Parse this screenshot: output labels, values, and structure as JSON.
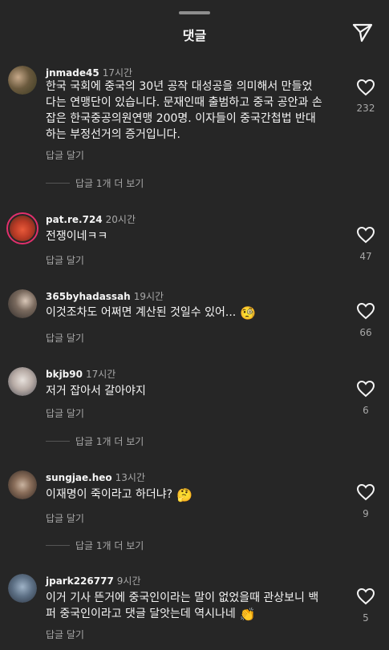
{
  "header": {
    "title": "댓글"
  },
  "comments": [
    {
      "username": "jnmade45",
      "time": "17시간",
      "text": "한국 국회에 중국의 30년 공작 대성공을 의미해서 만들었\n다는 연맹단이 있습니다. 문재인때 출범하고 중국 공안과 손\n잡은 한국중공의원연맹 200명. 이자들이 중국간첩법 반대\n하는 부정선거의 증거입니다.",
      "reply_label": "답글 달기",
      "likes": "232",
      "more_replies": "답글 1개 더 보기"
    },
    {
      "username": "pat.re.724",
      "time": "20시간",
      "text": "전쟁이네ㅋㅋ",
      "reply_label": "답글 달기",
      "likes": "47"
    },
    {
      "username": "365byhadassah",
      "time": "19시간",
      "text": "이것조차도 어쩌면 계산된 것일수 있어...",
      "emoji": "🧐",
      "reply_label": "답글 달기",
      "likes": "66"
    },
    {
      "username": "bkjb90",
      "time": "17시간",
      "text": "저거 잡아서 갈아야지",
      "reply_label": "답글 달기",
      "likes": "6",
      "more_replies": "답글 1개 더 보기"
    },
    {
      "username": "sungjae.heo",
      "time": "13시간",
      "text": "이재명이 죽이라고 하더냐?",
      "emoji": "🤔",
      "reply_label": "답글 달기",
      "likes": "9",
      "more_replies": "답글 1개 더 보기"
    },
    {
      "username": "jpark226777",
      "time": "9시간",
      "text": "이거 기사 뜬거에 중국인이라는 말이 없었을때 관상보니 백\n퍼 중국인이라고 댓글 달앗는데 역시나네",
      "emoji": "👏",
      "reply_label": "답글 달기",
      "likes": "5"
    }
  ]
}
